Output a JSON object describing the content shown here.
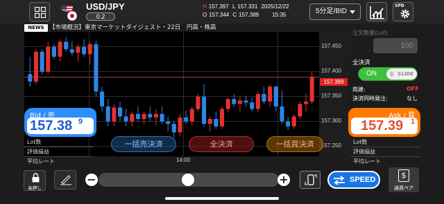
{
  "header": {
    "pair": "USD/JPY",
    "spread": "0.2",
    "ohlc": {
      "h_key": "H",
      "h_val": "157.397",
      "l_key": "L",
      "l_val": "157.331",
      "date": "2025/12/22",
      "o_key": "O",
      "o_val": "157.344",
      "c_key": "C",
      "c_val": "157.389",
      "time": "15:35"
    },
    "timeframe": "5分足/BID",
    "spd_label": "SPD"
  },
  "news": {
    "tag": "NEWS",
    "text": "【市場概況】東京マーケットダイジェスト・22日　円高・株高"
  },
  "chart": {
    "yaxis": [
      "157.450",
      "157.400",
      "157.350",
      "157.300",
      "157.250"
    ],
    "current_price": "157.389",
    "xaxis": [
      "14:00"
    ],
    "overlay_buttons": {
      "sell_all": "一括売決済",
      "all_settle": "全決済",
      "buy_all": "一括買決済"
    }
  },
  "chart_data": {
    "type": "candlestick",
    "ylim": [
      157.23,
      157.48
    ],
    "up_color": "#e53030",
    "down_color": "#2b86e8",
    "candles": [
      [
        157.395,
        157.43,
        157.37,
        157.38
      ],
      [
        157.38,
        157.445,
        157.375,
        157.44
      ],
      [
        157.44,
        157.445,
        157.395,
        157.4
      ],
      [
        157.4,
        157.46,
        157.395,
        157.45
      ],
      [
        157.45,
        157.455,
        157.425,
        157.43
      ],
      [
        157.43,
        157.465,
        157.42,
        157.46
      ],
      [
        157.46,
        157.47,
        157.44,
        157.445
      ],
      [
        157.445,
        157.462,
        157.432,
        157.438
      ],
      [
        157.438,
        157.455,
        157.42,
        157.45
      ],
      [
        157.45,
        157.465,
        157.43,
        157.435
      ],
      [
        157.435,
        157.46,
        157.415,
        157.455
      ],
      [
        157.455,
        157.462,
        157.35,
        157.36
      ],
      [
        157.36,
        157.37,
        157.32,
        157.33
      ],
      [
        157.33,
        157.345,
        157.29,
        157.3
      ],
      [
        157.3,
        157.335,
        157.29,
        157.328
      ],
      [
        157.328,
        157.34,
        157.3,
        157.31
      ],
      [
        157.31,
        157.325,
        157.29,
        157.3
      ],
      [
        157.3,
        157.32,
        157.29,
        157.315
      ],
      [
        157.315,
        157.33,
        157.3,
        157.305
      ],
      [
        157.305,
        157.32,
        157.295,
        157.315
      ],
      [
        157.315,
        157.33,
        157.3,
        157.308
      ],
      [
        157.308,
        157.325,
        157.292,
        157.315
      ],
      [
        157.315,
        157.33,
        157.295,
        157.3
      ],
      [
        157.3,
        157.31,
        157.28,
        157.295
      ],
      [
        157.295,
        157.302,
        157.268,
        157.278
      ],
      [
        157.278,
        157.315,
        157.27,
        157.308
      ],
      [
        157.308,
        157.322,
        157.295,
        157.3
      ],
      [
        157.3,
        157.33,
        157.292,
        157.325
      ],
      [
        157.325,
        157.355,
        157.32,
        157.35
      ],
      [
        157.35,
        157.375,
        157.29,
        157.295
      ],
      [
        157.295,
        157.31,
        157.28,
        157.305
      ],
      [
        157.305,
        157.32,
        157.285,
        157.29
      ],
      [
        157.29,
        157.33,
        157.285,
        157.325
      ],
      [
        157.325,
        157.348,
        157.318,
        157.345
      ],
      [
        157.345,
        157.355,
        157.33,
        157.335
      ],
      [
        157.335,
        157.35,
        157.32,
        157.342
      ],
      [
        157.342,
        157.352,
        157.33,
        157.338
      ],
      [
        157.338,
        157.348,
        157.32,
        157.325
      ],
      [
        157.325,
        157.36,
        157.32,
        157.355
      ],
      [
        157.355,
        157.37,
        157.335,
        157.34
      ],
      [
        157.34,
        157.375,
        157.33,
        157.37
      ],
      [
        157.37,
        157.372,
        157.32,
        157.33
      ],
      [
        157.33,
        157.362,
        157.295,
        157.3
      ],
      [
        157.3,
        157.31,
        157.282,
        157.29
      ],
      [
        157.29,
        157.315,
        157.285,
        157.31
      ],
      [
        157.31,
        157.34,
        157.305,
        157.335
      ],
      [
        157.335,
        157.355,
        157.32,
        157.34
      ],
      [
        157.34,
        157.4,
        157.335,
        157.389
      ]
    ]
  },
  "bid": {
    "label": "Bid / 売",
    "price_main": "157.38",
    "price_pip": "9"
  },
  "ask": {
    "label": "Ask / 買",
    "price_main": "157.39",
    "price_pip": "1"
  },
  "left_info": {
    "lot": "Lot数",
    "pnl": "評価損益",
    "avg": "平均レート"
  },
  "right_info": {
    "lot": "Lot数",
    "pnl": "評価損益",
    "avg": "平均レート"
  },
  "order_panel": {
    "qty_label": "注文数量(Lot)",
    "qty_value": "100",
    "settle_label": "全決済",
    "toggle_on": "ON",
    "toggle_slide": "SLIDE",
    "both_label": "両建:",
    "both_value": "OFF",
    "simul_label": "決済同時発注:",
    "simul_value": "なし"
  },
  "bottom": {
    "lock_label": "長押し",
    "speed_label": "SPEED",
    "pair_label": "通貨ペア",
    "pair_symbol": "$"
  }
}
